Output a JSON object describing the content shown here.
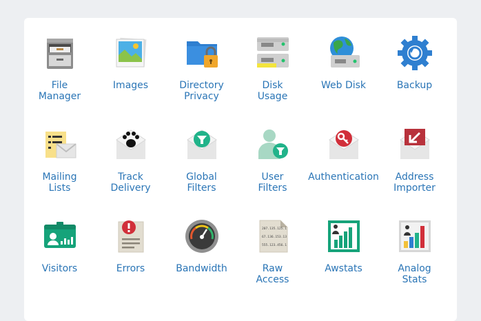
{
  "items": [
    {
      "id": "file-manager",
      "icon": "file-cabinet-icon",
      "lines": [
        "File",
        "Manager"
      ]
    },
    {
      "id": "images",
      "icon": "photo-icon",
      "lines": [
        "Images",
        ""
      ]
    },
    {
      "id": "directory-privacy",
      "icon": "locked-folder-icon",
      "lines": [
        "Directory",
        "Privacy"
      ]
    },
    {
      "id": "disk-usage",
      "icon": "disk-drives-icon",
      "lines": [
        "Disk",
        "Usage"
      ]
    },
    {
      "id": "web-disk",
      "icon": "globe-drive-icon",
      "lines": [
        "Web Disk",
        ""
      ]
    },
    {
      "id": "backup",
      "icon": "backup-gear-icon",
      "lines": [
        "Backup",
        ""
      ]
    },
    {
      "id": "mailing-lists",
      "icon": "mail-list-icon",
      "lines": [
        "Mailing",
        "Lists"
      ]
    },
    {
      "id": "track-delivery",
      "icon": "paw-envelope-icon",
      "lines": [
        "Track",
        "Delivery"
      ]
    },
    {
      "id": "global-filters",
      "icon": "filter-envelope-icon",
      "lines": [
        "Global",
        "Filters"
      ]
    },
    {
      "id": "user-filters",
      "icon": "user-filter-icon",
      "lines": [
        "User",
        "Filters"
      ]
    },
    {
      "id": "authentication",
      "icon": "key-envelope-icon",
      "lines": [
        "Authentication",
        ""
      ]
    },
    {
      "id": "address-importer",
      "icon": "import-envelope-icon",
      "lines": [
        "Address",
        "Importer"
      ]
    },
    {
      "id": "visitors",
      "icon": "visitor-badge-icon",
      "lines": [
        "Visitors",
        ""
      ]
    },
    {
      "id": "errors",
      "icon": "error-document-icon",
      "lines": [
        "Errors",
        ""
      ]
    },
    {
      "id": "bandwidth",
      "icon": "gauge-icon",
      "lines": [
        "Bandwidth",
        ""
      ]
    },
    {
      "id": "raw-access",
      "icon": "ip-log-document-icon",
      "lines": [
        "Raw",
        "Access"
      ]
    },
    {
      "id": "awstats",
      "icon": "stats-chart-icon",
      "lines": [
        "Awstats",
        ""
      ]
    },
    {
      "id": "analog-stats",
      "icon": "analog-chart-icon",
      "lines": [
        "Analog",
        "Stats"
      ]
    }
  ],
  "raw_access_ips": [
    "207.135.125.1",
    "67.136.153.13",
    "555.123.456.1"
  ],
  "colors": {
    "link": "#2a75b6",
    "panel": "#ffffff",
    "background": "#edeff2",
    "accent_blue": "#2f7fd0",
    "accent_green": "#21b38a",
    "accent_red": "#d12f3a"
  }
}
